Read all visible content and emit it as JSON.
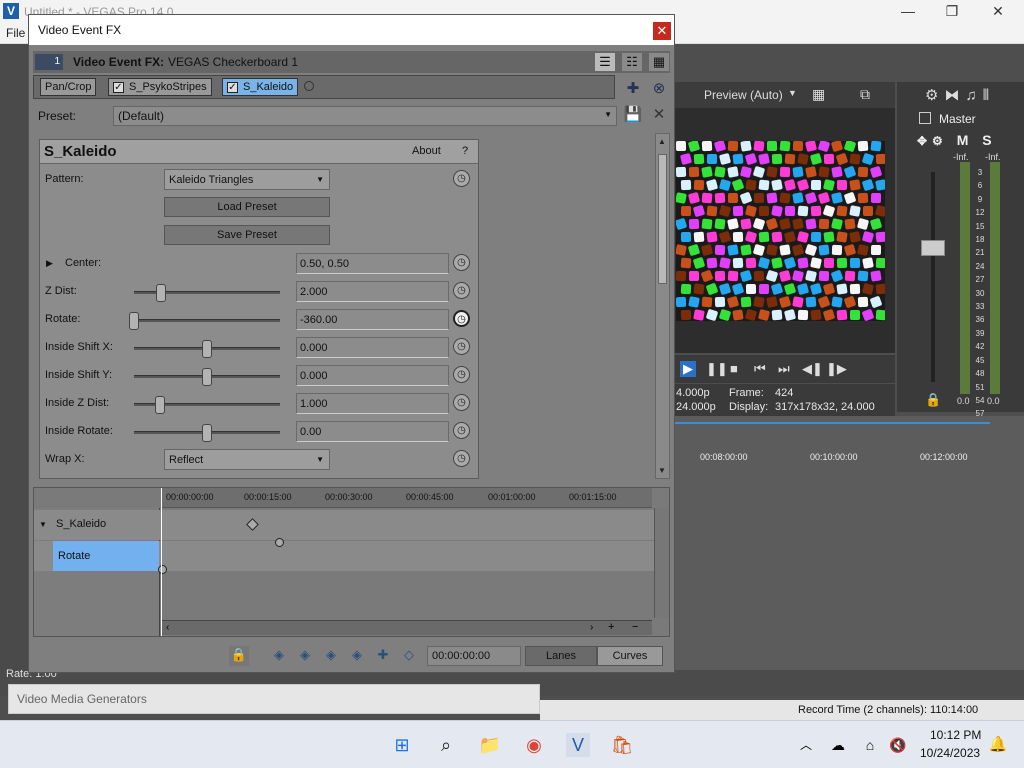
{
  "app": {
    "window_title": "Untitled * - VEGAS Pro 14.0",
    "menu_file": "File",
    "rate_label": "Rate: 1.00",
    "record_time": "Record Time (2 channels): 110:14:00",
    "video_media_generators": "Video Media Generators"
  },
  "preview": {
    "quality": "Preview (Auto)",
    "info_line1_left": "4.000p",
    "info_frame_label": "Frame:",
    "info_frame_value": "424",
    "info_line2_left": "24.000p",
    "info_display_label": "Display:",
    "info_display_value": "317x178x32, 24.000"
  },
  "master": {
    "label": "Master",
    "msm": "M S",
    "inf_left": "-Inf.",
    "inf_right": "-Inf.",
    "scale": [
      "3",
      "6",
      "9",
      "12",
      "15",
      "18",
      "21",
      "24",
      "27",
      "30",
      "33",
      "36",
      "39",
      "42",
      "45",
      "48",
      "51",
      "54",
      "57"
    ],
    "peak_left": "0.0",
    "peak_right": "0.0"
  },
  "timeline": {
    "ruler": [
      "00:08:00:00",
      "00:10:00:00",
      "00:12:00:00"
    ]
  },
  "dialog": {
    "title": "Video Event FX",
    "header_label": "Video Event FX:",
    "header_value": "VEGAS Checkerboard 1",
    "track_num": "1",
    "chain": [
      {
        "label": "Pan/Crop",
        "checked": false
      },
      {
        "label": "S_PsykoStripes",
        "checked": true
      },
      {
        "label": "S_Kaleido",
        "checked": true
      }
    ],
    "preset_label": "Preset:",
    "preset_value": "(Default)",
    "plugin": {
      "name": "S_Kaleido",
      "about": "About",
      "help": "?",
      "pattern_label": "Pattern:",
      "pattern_value": "Kaleido Triangles",
      "load_preset": "Load Preset",
      "save_preset": "Save Preset",
      "center_label": "Center:",
      "center_value": "0.50, 0.50",
      "zdist_label": "Z Dist:",
      "zdist_value": "2.000",
      "rotate_label": "Rotate:",
      "rotate_value": "-360.00",
      "ishiftx_label": "Inside Shift X:",
      "ishiftx_value": "0.000",
      "ishifty_label": "Inside Shift Y:",
      "ishifty_value": "0.000",
      "izdist_label": "Inside Z Dist:",
      "izdist_value": "1.000",
      "irotate_label": "Inside Rotate:",
      "irotate_value": "0.00",
      "wrapx_label": "Wrap X:",
      "wrapx_value": "Reflect"
    },
    "keyframes": {
      "ruler": [
        "00:00:00:00",
        "00:00:15:00",
        "00:00:30:00",
        "00:00:45:00",
        "00:01:00:00",
        "00:01:15:00"
      ],
      "track_name": "S_Kaleido",
      "param_name": "Rotate",
      "time": "00:00:00:00",
      "mode_lanes": "Lanes",
      "mode_curves": "Curves"
    }
  },
  "taskbar": {
    "time": "10:12 PM",
    "date": "10/24/2023"
  }
}
